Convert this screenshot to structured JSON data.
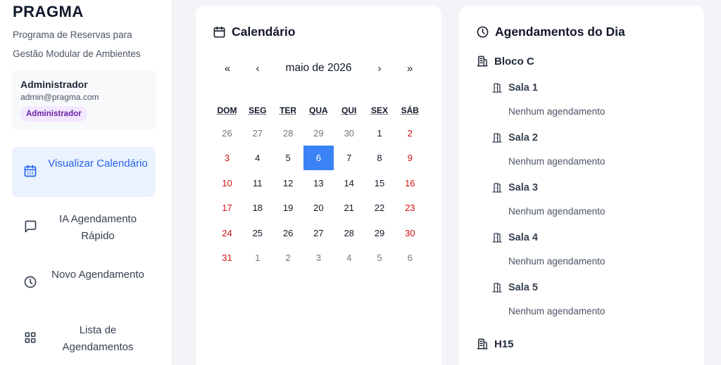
{
  "brand": {
    "title": "PRAGMA",
    "subtitle": "Programa de Reservas para Gestão Modular de Ambientes"
  },
  "user": {
    "name": "Administrador",
    "email": "admin@pragma.com",
    "role": "Administrador"
  },
  "nav": [
    {
      "label": "Visualizar Calendário",
      "icon": "calendar-icon",
      "active": true
    },
    {
      "label": "IA Agendamento Rápido",
      "icon": "chat-icon",
      "active": false
    },
    {
      "label": "Novo Agendamento",
      "icon": "clock-icon",
      "active": false
    },
    {
      "label": "Lista de Agendamentos",
      "icon": "grid-icon",
      "active": false
    }
  ],
  "calendar": {
    "title": "Calendário",
    "month_label": "maio de 2026",
    "nav": {
      "prev_year": "«",
      "prev_month": "‹",
      "next_month": "›",
      "next_year": "»"
    },
    "weekdays": [
      "DOM",
      "SEG",
      "TER",
      "QUA",
      "QUI",
      "SEX",
      "SÁB"
    ],
    "selected_day": "6",
    "weeks": [
      [
        "26",
        "27",
        "28",
        "29",
        "30",
        "1",
        "2"
      ],
      [
        "3",
        "4",
        "5",
        "6",
        "7",
        "8",
        "9"
      ],
      [
        "10",
        "11",
        "12",
        "13",
        "14",
        "15",
        "16"
      ],
      [
        "17",
        "18",
        "19",
        "20",
        "21",
        "22",
        "23"
      ],
      [
        "24",
        "25",
        "26",
        "27",
        "28",
        "29",
        "30"
      ],
      [
        "31",
        "1",
        "2",
        "3",
        "4",
        "5",
        "6"
      ]
    ],
    "colors": {
      "selected": "#3b82f6",
      "weekend": "#d01010",
      "muted": "#757575"
    }
  },
  "agenda": {
    "title": "Agendamentos do Dia",
    "blocos": [
      {
        "name": "Bloco C",
        "salas": [
          {
            "name": "Sala 1",
            "status": "Nenhum agendamento"
          },
          {
            "name": "Sala 2",
            "status": "Nenhum agendamento"
          },
          {
            "name": "Sala 3",
            "status": "Nenhum agendamento"
          },
          {
            "name": "Sala 4",
            "status": "Nenhum agendamento"
          },
          {
            "name": "Sala 5",
            "status": "Nenhum agendamento"
          }
        ]
      },
      {
        "name": "H15",
        "salas": []
      }
    ]
  }
}
